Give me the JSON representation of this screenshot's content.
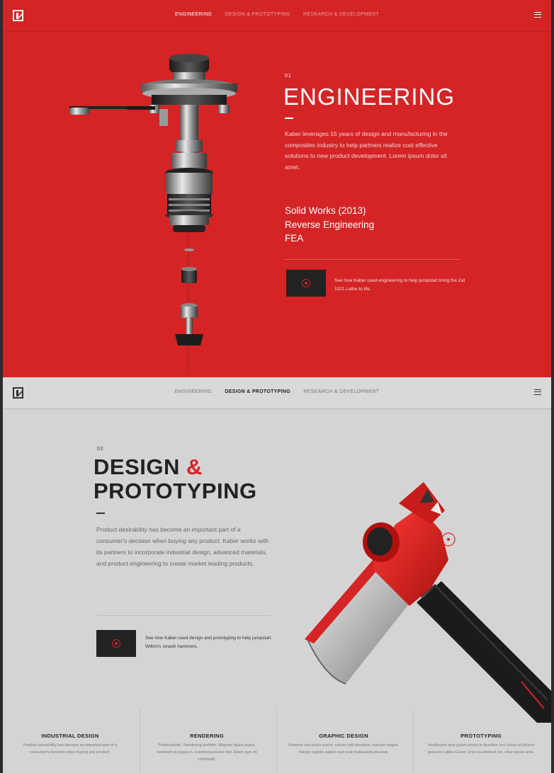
{
  "engineering_section": {
    "nav": {
      "items": [
        {
          "label": "ENGINEERING",
          "active": true
        },
        {
          "label": "DESIGN & PROTOTYPING",
          "active": false
        },
        {
          "label": "RESEARCH & DEVELOPMENT",
          "active": false
        }
      ]
    },
    "number": "01",
    "title": "ENGINEERING",
    "description": "Kaber leverages 15 years of design and manufacturing in the composites industry to help partners realize cost effective solutions to new product development. Lorem ipsum dolor sit amet.",
    "skills": [
      "Solid Works (2013)",
      "Reverse Engineering",
      "FEA"
    ],
    "case_study": "See how Kaber used engineering to help jumpstart bring the Zat 1021 Lathe to life."
  },
  "design_section": {
    "nav": {
      "items": [
        {
          "label": "ENGINEERING",
          "active": false
        },
        {
          "label": "DESIGN & PROTOTYPING",
          "active": true
        },
        {
          "label": "RESEARCH & DEVELOPMENT",
          "active": false
        }
      ]
    },
    "number": "02",
    "title_part1": "DESIGN ",
    "title_amp": "&",
    "title_part2": "PROTOTYPING",
    "description": "Product desirability has become an important part of a consumer's decision when buying any product. Kaber works with its partners to incorporate industrial design, advanced materials, and product engineering to create market leading products.",
    "case_study": "See how Kaber used design and prototyping to help jumpstart Wilton's smash hammers."
  },
  "services": [
    {
      "title": "INDUSTRIAL DESIGN",
      "text": "Product desirability has become an important part of a consumer's decision when buying any product."
    },
    {
      "title": "RENDERING",
      "text": "Photorealistic. Rendering portfolio. Aliquam ligula neque, hendrerit at augue in, euismod posuere nisl. Etiam quis mi commodo."
    },
    {
      "title": "GRAPHIC DESIGN",
      "text": "Vivamus sed turpis auctor, rutrum velit tincidunt, suscipit magna. Integer sagittis sapien quis erat malesuada placerat."
    },
    {
      "title": "PROTOTYPING",
      "text": "Vestibulum ante ipsum primis in faucibus orci luctus et ultrices posuere cubilia Curae; Cras eu eleifend est, vitae iaculis ante."
    }
  ],
  "colors": {
    "accent": "#d42426",
    "light_bg": "#d4d4d4",
    "dark": "#222222"
  }
}
